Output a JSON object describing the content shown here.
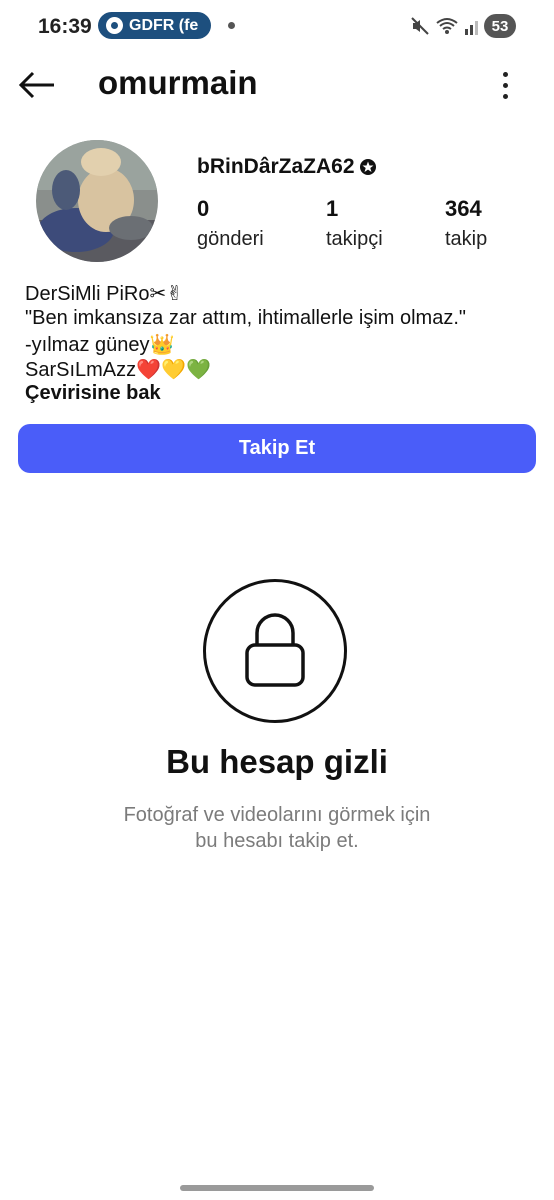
{
  "status_bar": {
    "time": "16:39",
    "notification_pill": "GDFR (fe",
    "battery": "53"
  },
  "header": {
    "username": "omurmain",
    "back_icon": "arrow-left-icon",
    "more_icon": "more-vertical-icon"
  },
  "profile": {
    "full_name": "bRinDârZaZA62",
    "stats": [
      {
        "count": "0",
        "label": "gönderi"
      },
      {
        "count": "1",
        "label": "takipçi"
      },
      {
        "count": "364",
        "label": "takip"
      }
    ],
    "bio_lines": [
      "DerSiMli PiRo✂✌",
      "\"Ben imkansıza zar attım, ihtimallerle işim olmaz.\"",
      "-yılmaz güney👑",
      "SarSıLmAzz❤️💛💚"
    ],
    "translate_link": "Çevirisine bak"
  },
  "follow_button": {
    "label": "Takip Et",
    "color": "#4a5df9"
  },
  "private_notice": {
    "title": "Bu hesap gizli",
    "subtitle_line1": "Fotoğraf ve videolarını görmek için",
    "subtitle_line2": "bu hesabı takip et.",
    "icon": "lock-icon"
  }
}
